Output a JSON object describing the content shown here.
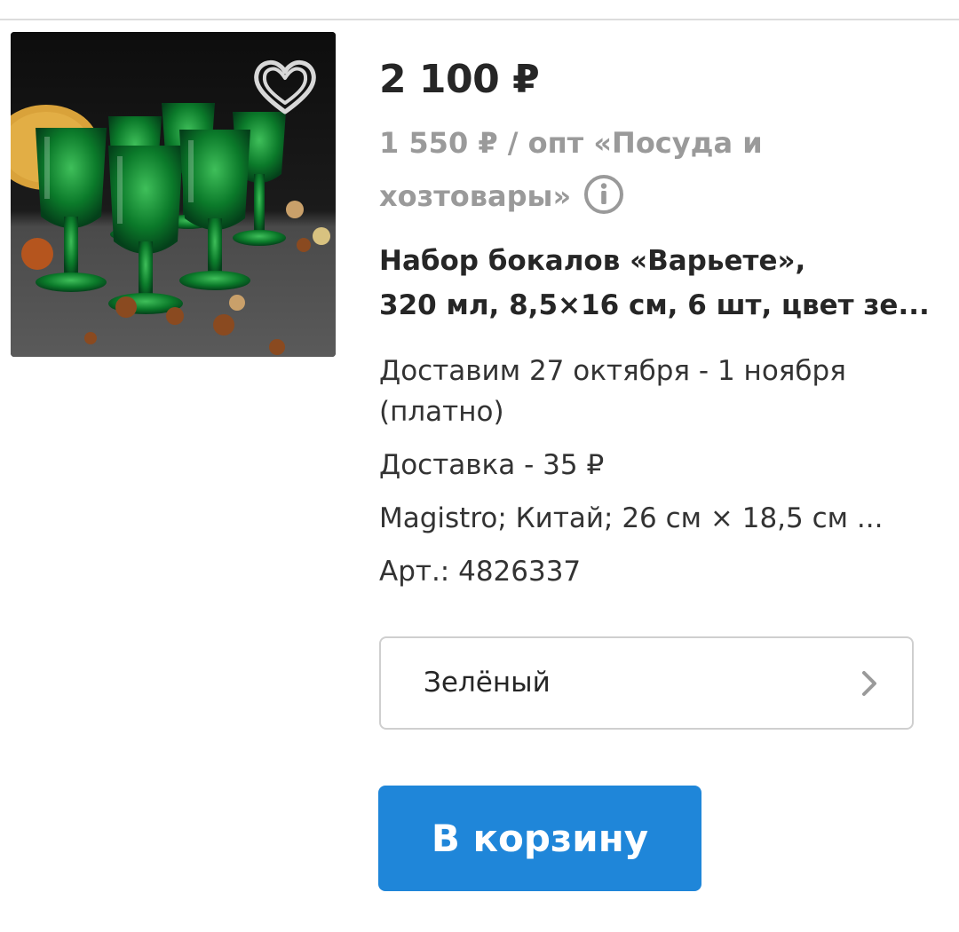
{
  "product": {
    "price": "2 100 ₽",
    "wholesale": {
      "text": "1 550 ₽ / опт «Посуда и хозтовары»",
      "info_icon": "info-icon"
    },
    "title_lines": [
      "Набор бокалов «Варьете»,",
      "320 мл, 8,5×16 см, 6 шт, цвет зе..."
    ],
    "delivery_dates": "Доставим 27 октября - 1 ноября (платно)",
    "delivery_cost": "Доставка - 35 ₽",
    "specs": "Magistro; Китай; 26 см × 18,5 см ...",
    "article": "Арт.: 4826337",
    "image_description_icon": "favorite-heart-icon"
  },
  "variant": {
    "selected": "Зелёный",
    "icon": "chevron-right-icon"
  },
  "actions": {
    "add_to_cart": "В корзину"
  },
  "colors": {
    "accent": "#1f86d9",
    "text": "#262626",
    "muted": "#9a9a9a",
    "border": "#cfcfcf"
  }
}
